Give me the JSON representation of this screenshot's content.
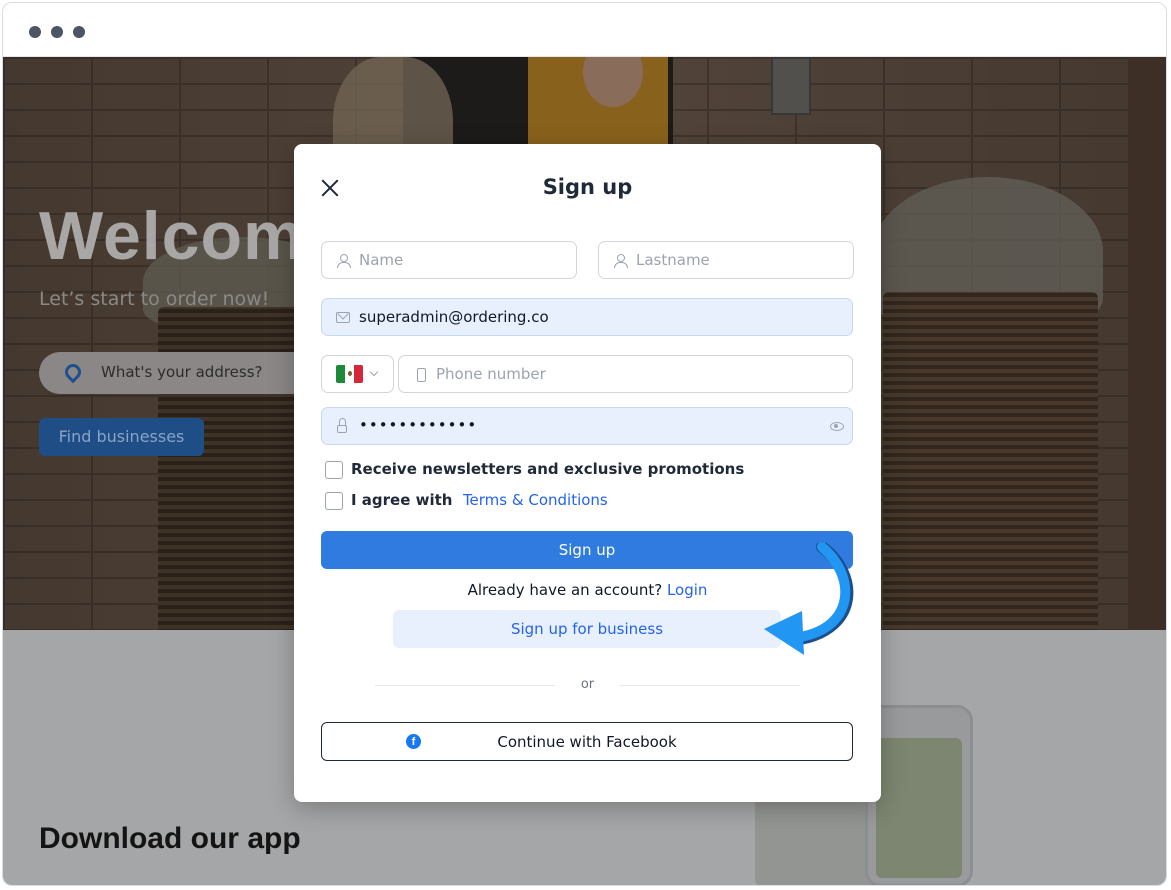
{
  "window": {
    "controls": [
      "dot",
      "dot",
      "dot"
    ]
  },
  "hero": {
    "title": "Welcom",
    "subtitle": "Let’s start to order now!",
    "address_placeholder": "What's your address?",
    "find_button": "Find businesses"
  },
  "lower": {
    "download_title": "Download our app"
  },
  "modal": {
    "title": "Sign up",
    "name_placeholder": "Name",
    "lastname_placeholder": "Lastname",
    "email_value": "superadmin@ordering.co",
    "country_flag": "mexico-flag-icon",
    "phone_placeholder": "Phone number",
    "password_value": "••••••••••••",
    "newsletter_label": "Receive newsletters and exclusive promotions",
    "agree_label": "I agree with",
    "terms_link": "Terms & Conditions",
    "signup_button": "Sign up",
    "already_text": "Already have an account?",
    "login_link": "Login",
    "business_button": "Sign up for business",
    "or_text": "or",
    "facebook_button": "Continue with Facebook"
  },
  "colors": {
    "primary": "#2f7be0",
    "link": "#2563eb",
    "facebook": "#1877f2",
    "arrow": "#2196f3"
  }
}
